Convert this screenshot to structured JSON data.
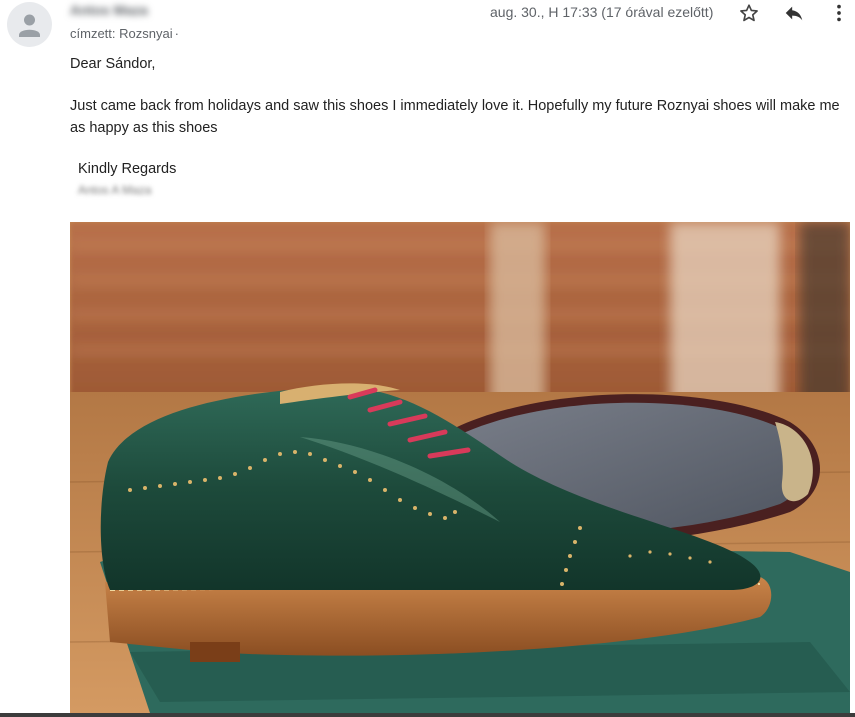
{
  "header": {
    "sender_name": "Antos Maza",
    "recipient_label": "címzett: Rozsnyai",
    "recipient_more": "·",
    "date": "aug. 30., H 17:33 (17 órával ezelőtt)",
    "icons": [
      "person-icon",
      "star-icon",
      "reply-icon",
      "more-vert-icon"
    ]
  },
  "body": {
    "greeting": "Dear Sándor,",
    "paragraph": "Just came back from holidays and saw this shoes I immediately love it.  Hopefully my future Roznyai shoes will make me as happy as this shoes",
    "closing": "Kindly Regards",
    "signature": "Antos A Maza"
  },
  "attachment": {
    "kind": "photo",
    "subject": "green leather wholecut oxford shoe with red laces"
  },
  "colors": {
    "shoe_green": "#1f4a3a",
    "laces": "#d83a5a",
    "sole": "#b06a36",
    "wood_floor": "#c58a52",
    "sock": "#2f6a5e"
  }
}
